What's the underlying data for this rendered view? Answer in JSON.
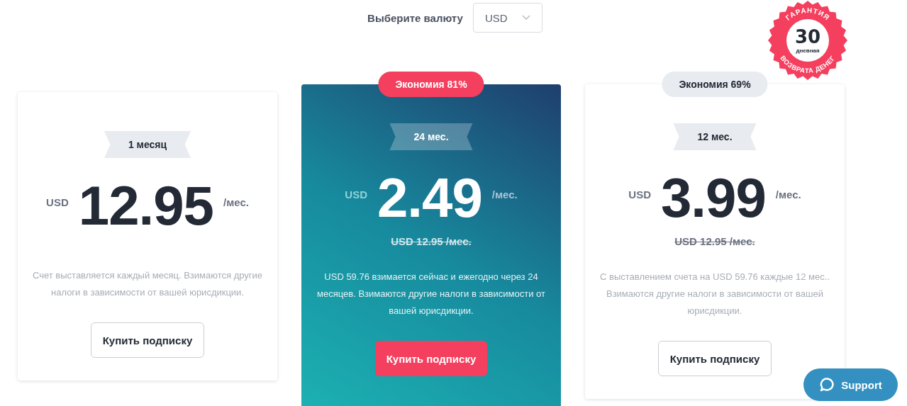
{
  "currency_picker": {
    "label": "Выберите валюту",
    "value": "USD"
  },
  "guarantee_seal": {
    "top_text": "ГАРАНТИЯ",
    "number": "30",
    "unit": "дневная",
    "bottom_text": "ВОЗВРАТА ДЕНЕГ"
  },
  "plans": [
    {
      "featured": false,
      "period": "1 месяц",
      "currency": "USD",
      "price": "12.95",
      "per": "/мес.",
      "note": "Счет выставляется каждый месяц. Взимаются другие налоги в зависимости от вашей юрисдикции.",
      "button": "Купить подписку"
    },
    {
      "featured": true,
      "badge": "Экономия 81%",
      "period": "24 мес.",
      "currency": "USD",
      "price": "2.49",
      "per": "/мес.",
      "old_price": "USD 12.95 /мес.",
      "note": "USD 59.76 взимается сейчас и ежегодно через 24 месяцев. Взимаются другие налоги в зависимости от вашей юрисдикции.",
      "button": "Купить подписку"
    },
    {
      "featured": false,
      "badge": "Экономия 69%",
      "period": "12 мес.",
      "currency": "USD",
      "price": "3.99",
      "per": "/мес.",
      "old_price": "USD 12.95 /мес.",
      "note": "С выставлением счета на USD 59.76 каждые 12 мес.. Взимаются другие налоги в зависимости от вашей юрисдикции.",
      "button": "Купить подписку"
    }
  ],
  "support_button": {
    "label": "Support"
  }
}
